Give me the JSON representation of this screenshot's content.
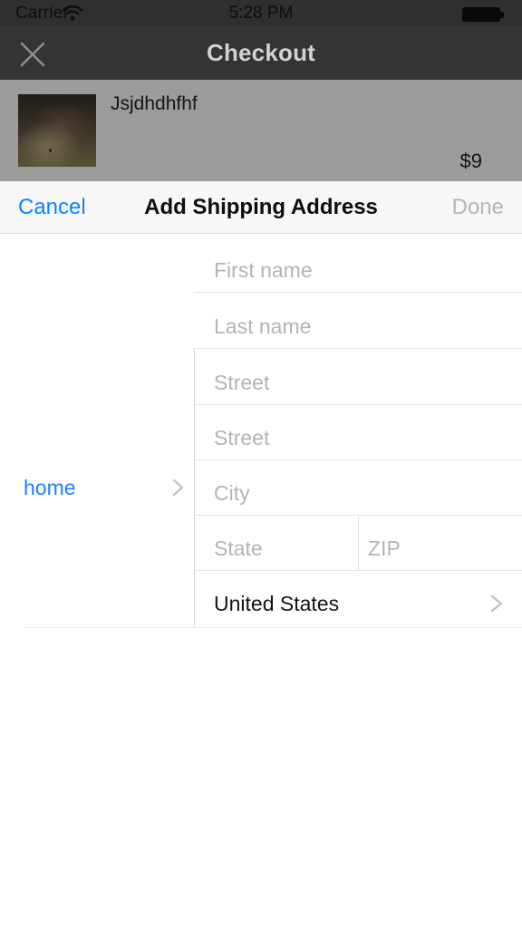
{
  "status_bar": {
    "carrier": "Carrier",
    "wifi_icon": "wifi-icon",
    "time": "5:28 PM",
    "battery_icon": "battery-full-icon"
  },
  "nav_bar": {
    "title": "Checkout",
    "close_icon": "close-x-icon",
    "background_color": "#343434",
    "title_color": "#d2d2d2"
  },
  "product": {
    "title": "Jsjdhdhfhf",
    "price": "$9",
    "thumbnail_alt": "product-photo",
    "row_background_color": "#9b9b9b"
  },
  "toolbar": {
    "cancel_label": "Cancel",
    "title": "Add Shipping Address",
    "done_label": "Done",
    "cancel_color": "#0a84ff",
    "done_color": "#b6b6b6",
    "background_color": "#f7f7f7"
  },
  "address_label": {
    "text": "home",
    "color": "#1a82ff",
    "chevron_icon": "chevron-right-icon"
  },
  "form": {
    "first_name": {
      "placeholder": "First name",
      "value": ""
    },
    "last_name": {
      "placeholder": "Last name",
      "value": ""
    },
    "street_1": {
      "placeholder": "Street",
      "value": ""
    },
    "street_2": {
      "placeholder": "Street",
      "value": ""
    },
    "city": {
      "placeholder": "City",
      "value": ""
    },
    "state": {
      "placeholder": "State",
      "value": ""
    },
    "zip": {
      "placeholder": "ZIP",
      "value": ""
    },
    "country": {
      "value": "United States",
      "chevron_icon": "chevron-right-icon"
    },
    "placeholder_color": "#b4b4b4",
    "value_color": "#141414"
  }
}
